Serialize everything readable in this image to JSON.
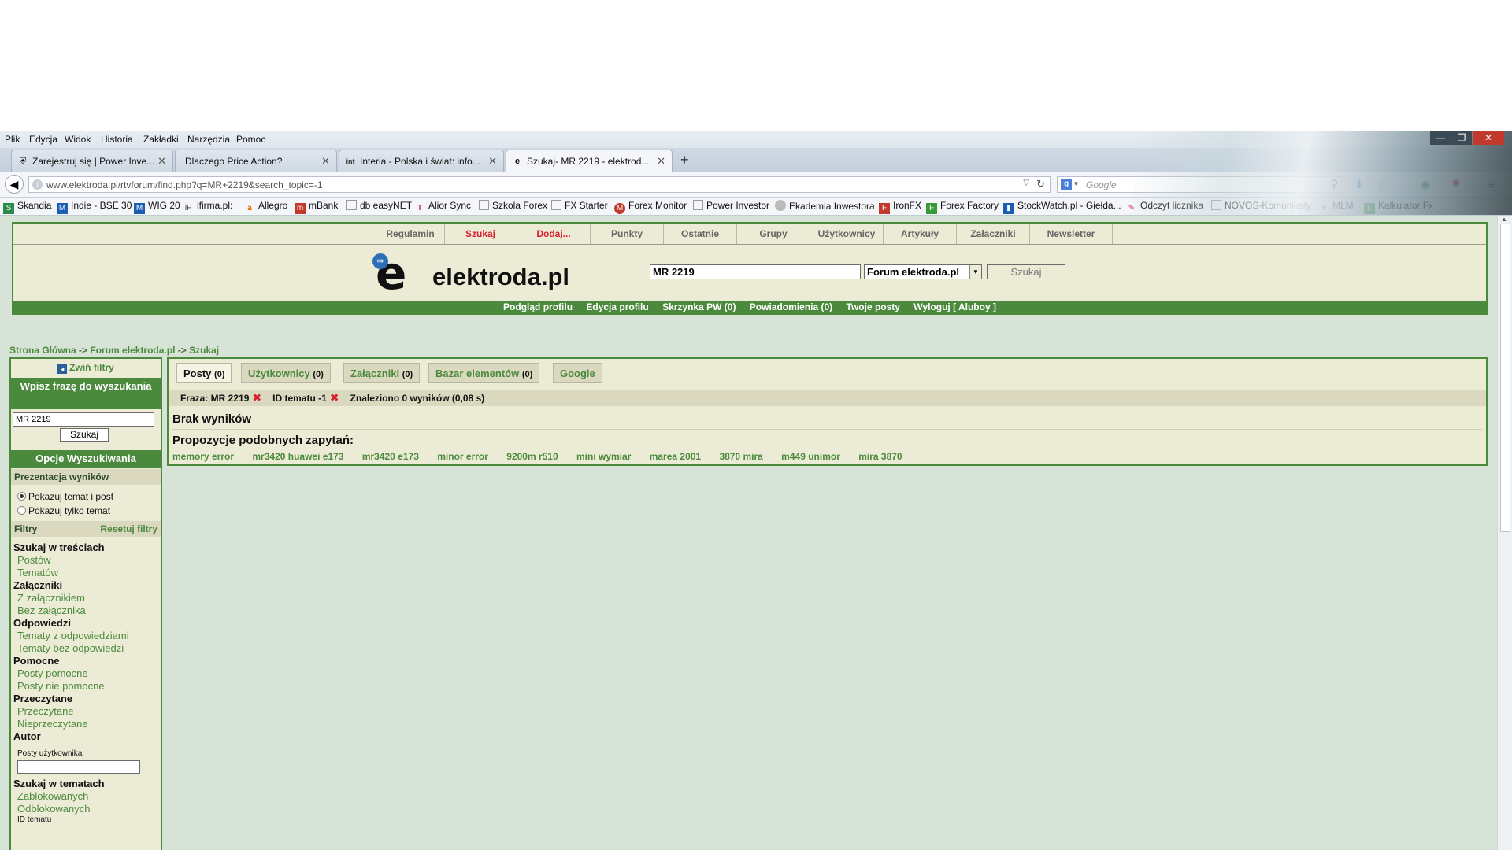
{
  "browser": {
    "menu": [
      "Plik",
      "Edycja",
      "Widok",
      "Historia",
      "Zakładki",
      "Narzędzia",
      "Pomoc"
    ],
    "tabs": [
      {
        "title": "Zarejestruj się | Power Inve...",
        "icon": "shield-icon"
      },
      {
        "title": "Dlaczego Price Action?",
        "icon": ""
      },
      {
        "title": "Interia - Polska i świat: info...",
        "icon": "int"
      },
      {
        "title": "Szukaj- MR 2219 - elektrod...",
        "icon": "e-icon"
      }
    ],
    "url": "www.elektroda.pl/rtvforum/find.php?q=MR+2219&search_topic=-1",
    "search_placeholder": "Google",
    "bookmarks": [
      "Skandia",
      "Indie - BSE 30",
      "WIG 20",
      "ifirma.pl:",
      "Allegro",
      "mBank",
      "db easyNET",
      "Alior Sync",
      "Szkola Forex",
      "FX Starter",
      "Forex Monitor",
      "Power Investor",
      "Ekademia Inwestora",
      "IronFX",
      "Forex Factory",
      "StockWatch.pl - Giełda...",
      "Odczyt licznika",
      "NOVOS-Komunikaty",
      "MLM",
      "Kalkulator Fx"
    ]
  },
  "header": {
    "nav": [
      "Regulamin",
      "Szukaj",
      "Dodaj...",
      "Punkty",
      "Ostatnie",
      "Grupy",
      "Użytkownicy",
      "Artykuły",
      "Załączniki",
      "Newsletter"
    ],
    "logo": "elektroda.pl",
    "logo_e": "e",
    "search_value": "MR 2219",
    "scope": "Forum elektroda.pl",
    "search_button": "Szukaj",
    "user_nav": [
      "Podgląd profilu",
      "Edycja profilu",
      "Skrzynka PW (0)",
      "Powiadomienia (0)",
      "Twoje posty",
      "Wyloguj [ Aluboy ]"
    ]
  },
  "breadcrumb": {
    "home": "Strona Główna",
    "sep": "->",
    "forum": "Forum elektroda.pl",
    "current": "Szukaj"
  },
  "sidebar": {
    "collapse": "Zwiń filtry",
    "phrase_head": "Wpisz frazę do wyszukania",
    "phrase_value": "MR 2219",
    "search_button": "Szukaj",
    "options_head": "Opcje Wyszukiwania",
    "presentation_head": "Prezentacja wyników",
    "radio1": "Pokazuj temat i post",
    "radio2": "Pokazuj tylko temat",
    "filters": "Filtry",
    "reset": "Resetuj filtry",
    "g1": "Szukaj w treściach",
    "g1a": "Postów",
    "g1b": "Tematów",
    "g2": "Załączniki",
    "g2a": "Z załącznikiem",
    "g2b": "Bez załącznika",
    "g3": "Odpowiedzi",
    "g3a": "Tematy z odpowiedziami",
    "g3b": "Tematy bez odpowiedzi",
    "g4": "Pomocne",
    "g4a": "Posty pomocne",
    "g4b": "Posty nie pomocne",
    "g5": "Przeczytane",
    "g5a": "Przeczytane",
    "g5b": "Nieprzeczytane",
    "g6": "Autor",
    "author_label": "Posty użytkownika:",
    "g7": "Szukaj w tematach",
    "g7a": "Zablokowanych",
    "g7b": "Odblokowanych",
    "g7c": "ID tematu"
  },
  "results": {
    "tabs": [
      {
        "label": "Posty",
        "count": "(0)"
      },
      {
        "label": "Użytkownicy",
        "count": "(0)"
      },
      {
        "label": "Załączniki",
        "count": "(0)"
      },
      {
        "label": "Bazar elementów",
        "count": "(0)"
      },
      {
        "label": "Google",
        "count": ""
      }
    ],
    "phrase": "Fraza: MR 2219",
    "topic_id": "ID tematu -1",
    "found": "Znaleziono 0 wyników (0,08 s)",
    "remove_mark": "✖",
    "no_results": "Brak wyników",
    "similar_head": "Propozycje podobnych zapytań:",
    "suggestions": [
      "memory error",
      "mr3420 huawei e173",
      "mr3420 e173",
      "minor error",
      "9200m r510",
      "mini wymiar",
      "marea 2001",
      "3870 mira",
      "m449 unimor",
      "mira 3870"
    ]
  }
}
